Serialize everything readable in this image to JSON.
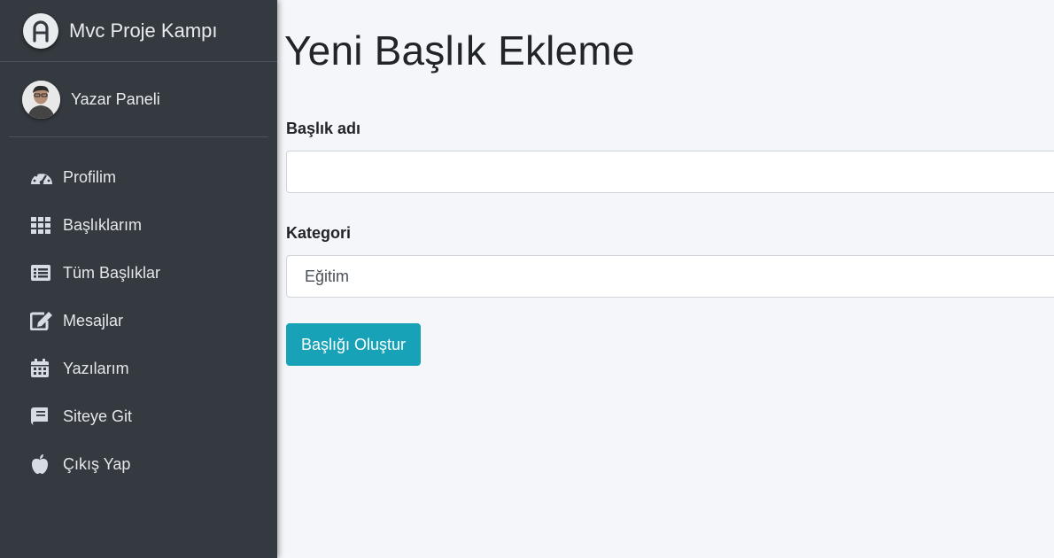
{
  "brand": {
    "name": "Mvc Proje Kampı",
    "logo_icon": "adminlte-logo-icon"
  },
  "user": {
    "name": "Yazar Paneli",
    "avatar_icon": "user-avatar"
  },
  "sidebar": {
    "items": [
      {
        "label": "Profilim",
        "icon": "tachometer-icon"
      },
      {
        "label": "Başlıklarım",
        "icon": "th-grid-icon"
      },
      {
        "label": "Tüm Başlıklar",
        "icon": "list-alt-icon"
      },
      {
        "label": "Mesajlar",
        "icon": "edit-icon"
      },
      {
        "label": "Yazılarım",
        "icon": "calendar-icon"
      },
      {
        "label": "Siteye Git",
        "icon": "book-icon"
      },
      {
        "label": "Çıkış Yap",
        "icon": "apple-icon"
      }
    ]
  },
  "main": {
    "title": "Yeni Başlık Ekleme",
    "heading_field": {
      "label": "Başlık adı",
      "value": "",
      "placeholder": ""
    },
    "category_field": {
      "label": "Kategori",
      "selected": "Eğitim"
    },
    "submit_label": "Başlığı Oluştur"
  },
  "colors": {
    "sidebar_bg": "#343a40",
    "content_bg": "#f4f6f9",
    "button": "#17a2b8"
  }
}
